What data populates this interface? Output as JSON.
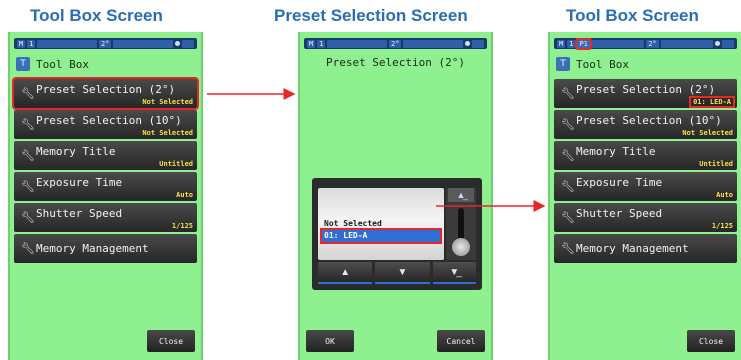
{
  "captions": {
    "left": "Tool Box Screen",
    "middle": "Preset Selection Screen",
    "right": "Tool Box Screen"
  },
  "status_bar": {
    "mode": "M",
    "num": "1",
    "preset_badge": "P1",
    "angle": "2°"
  },
  "toolbox": {
    "icon_text": "T",
    "title": "Tool Box",
    "items": [
      {
        "label": "Preset Selection (2°)",
        "value": "Not Selected"
      },
      {
        "label": "Preset Selection (10°)",
        "value": "Not Selected"
      },
      {
        "label": "Memory Title",
        "value": "Untitled"
      },
      {
        "label": "Exposure Time",
        "value": "Auto"
      },
      {
        "label": "Shutter Speed",
        "value": "1/125"
      },
      {
        "label": "Memory Management",
        "value": ""
      }
    ],
    "close_label": "Close"
  },
  "toolbox_after": {
    "preset_2_value": "01: LED-A"
  },
  "preset_screen": {
    "title": "Preset Selection (2°)",
    "options": [
      "Not Selected",
      "01: LED-A"
    ],
    "selected_index": 1,
    "ok_label": "OK",
    "cancel_label": "Cancel"
  },
  "icons": {
    "menu": "wrench-icon",
    "picker_up": "arrow-up-icon",
    "picker_down": "arrow-down-icon",
    "picker_top": "jump-top-icon",
    "picker_bottom": "jump-bottom-icon"
  },
  "colors": {
    "screen_bg": "#8ff08f",
    "caption": "#2a6db5",
    "highlight": "#e8262a",
    "value_text": "#f5e04a",
    "selection": "#2f6fd1"
  }
}
